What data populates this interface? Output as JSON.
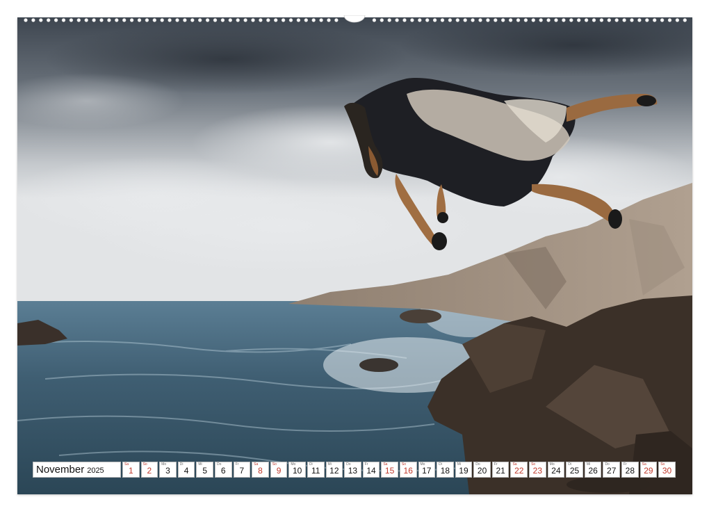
{
  "calendar": {
    "month": "November",
    "year": "2025",
    "days": [
      {
        "wd": "Sa",
        "d": "1",
        "weekend": true
      },
      {
        "wd": "So",
        "d": "2",
        "weekend": true
      },
      {
        "wd": "Mo",
        "d": "3",
        "weekend": false
      },
      {
        "wd": "Di",
        "d": "4",
        "weekend": false
      },
      {
        "wd": "Mi",
        "d": "5",
        "weekend": false
      },
      {
        "wd": "Do",
        "d": "6",
        "weekend": false
      },
      {
        "wd": "Fr",
        "d": "7",
        "weekend": false
      },
      {
        "wd": "Sa",
        "d": "8",
        "weekend": true
      },
      {
        "wd": "So",
        "d": "9",
        "weekend": true
      },
      {
        "wd": "Mo",
        "d": "10",
        "weekend": false
      },
      {
        "wd": "Di",
        "d": "11",
        "weekend": false
      },
      {
        "wd": "Mi",
        "d": "12",
        "weekend": false
      },
      {
        "wd": "Do",
        "d": "13",
        "weekend": false
      },
      {
        "wd": "Fr",
        "d": "14",
        "weekend": false
      },
      {
        "wd": "Sa",
        "d": "15",
        "weekend": true
      },
      {
        "wd": "So",
        "d": "16",
        "weekend": true
      },
      {
        "wd": "Mo",
        "d": "17",
        "weekend": false
      },
      {
        "wd": "Di",
        "d": "18",
        "weekend": false
      },
      {
        "wd": "Mi",
        "d": "19",
        "weekend": false
      },
      {
        "wd": "Do",
        "d": "20",
        "weekend": false
      },
      {
        "wd": "Fr",
        "d": "21",
        "weekend": false
      },
      {
        "wd": "Sa",
        "d": "22",
        "weekend": true
      },
      {
        "wd": "So",
        "d": "23",
        "weekend": true
      },
      {
        "wd": "Mo",
        "d": "24",
        "weekend": false
      },
      {
        "wd": "Di",
        "d": "25",
        "weekend": false
      },
      {
        "wd": "Mi",
        "d": "26",
        "weekend": false
      },
      {
        "wd": "Do",
        "d": "27",
        "weekend": false
      },
      {
        "wd": "Fr",
        "d": "28",
        "weekend": false
      },
      {
        "wd": "Sa",
        "d": "29",
        "weekend": true
      },
      {
        "wd": "So",
        "d": "30",
        "weekend": true
      }
    ]
  },
  "colors": {
    "weekend": "#c0392b",
    "weekday": "#111111"
  },
  "photo": {
    "subject": "dog-jumping-over-rocky-sea-coast"
  }
}
